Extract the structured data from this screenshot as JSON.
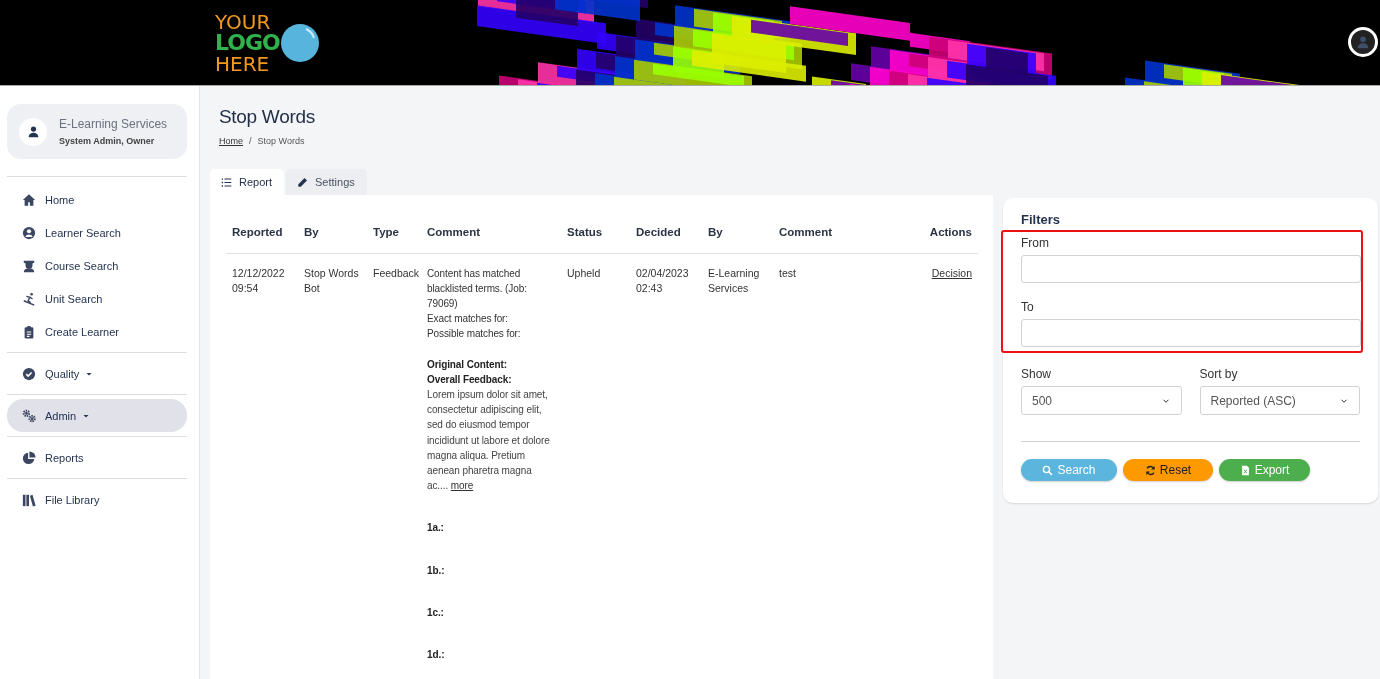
{
  "header": {
    "logo": {
      "lines": [
        "YOUR",
        "LOGO",
        "HERE"
      ]
    }
  },
  "sidebar": {
    "profile": {
      "name": "E-Learning Services",
      "role": "System Admin, Owner"
    },
    "groups": [
      {
        "items": [
          {
            "label": "Home",
            "kind": "link",
            "selected": false
          },
          {
            "label": "Learner Search",
            "kind": "link",
            "selected": false
          },
          {
            "label": "Course Search",
            "kind": "link",
            "selected": false
          },
          {
            "label": "Unit Search",
            "kind": "link",
            "selected": false
          },
          {
            "label": "Create Learner",
            "kind": "link",
            "selected": false
          }
        ]
      },
      {
        "items": [
          {
            "label": "Quality",
            "kind": "dropdown",
            "selected": false
          }
        ]
      },
      {
        "items": [
          {
            "label": "Admin",
            "kind": "dropdown",
            "selected": true
          }
        ]
      },
      {
        "items": [
          {
            "label": "Reports",
            "kind": "link",
            "selected": false
          }
        ]
      },
      {
        "items": [
          {
            "label": "File Library",
            "kind": "link",
            "selected": false
          }
        ]
      }
    ]
  },
  "page": {
    "title": "Stop Words",
    "breadcrumb_separator": "/",
    "breadcrumb": [
      {
        "label": "Home",
        "kind": "link"
      },
      {
        "label": "Stop Words",
        "kind": "current"
      }
    ]
  },
  "tabs": [
    {
      "label": "Report",
      "selected": true
    },
    {
      "label": "Settings",
      "selected": false
    }
  ],
  "table": {
    "columns": [
      "Reported",
      "By",
      "Type",
      "Comment",
      "Status",
      "Decided",
      "By",
      "Comment",
      "Actions"
    ],
    "rows": [
      {
        "reported": [
          "12/12/2022",
          "09:54"
        ],
        "by": "Stop Words Bot",
        "type": "Feedback",
        "comment": [
          {
            "kind": "text",
            "text": "Content has matched blacklisted terms. (Job: 79069)"
          },
          {
            "kind": "text",
            "text": "Exact matches for:"
          },
          {
            "kind": "text",
            "text": "Possible matches for:"
          },
          {
            "kind": "heading",
            "text": "Original Content:"
          },
          {
            "kind": "heading",
            "text": "Overall Feedback:"
          },
          {
            "kind": "excerpt",
            "text": "Lorem ipsum dolor sit amet, consectetur adipiscing elit, sed do eiusmod tempor incididunt ut labore et dolore magna aliqua. Pretium aenean pharetra magna ac....",
            "link": "more"
          },
          {
            "kind": "label",
            "text": "1a.:"
          },
          {
            "kind": "label",
            "text": "1b.:"
          },
          {
            "kind": "label",
            "text": "1c.:"
          },
          {
            "kind": "label",
            "text": "1d.:"
          }
        ],
        "status": "Upheld",
        "decided": [
          "02/04/2023",
          "02:43"
        ],
        "decided_by": "E-Learning Services",
        "decision_comment": "test",
        "action": "Decision"
      }
    ]
  },
  "filters": {
    "title": "Filters",
    "date_fields": [
      {
        "label": "From"
      },
      {
        "label": "To"
      }
    ],
    "selects": [
      {
        "label": "Show",
        "value": "500"
      },
      {
        "label": "Sort by",
        "value": "Reported (ASC)"
      }
    ],
    "buttons": [
      {
        "label": "Search",
        "kind": "search"
      },
      {
        "label": "Reset",
        "kind": "reset"
      },
      {
        "label": "Export",
        "kind": "export"
      }
    ]
  }
}
